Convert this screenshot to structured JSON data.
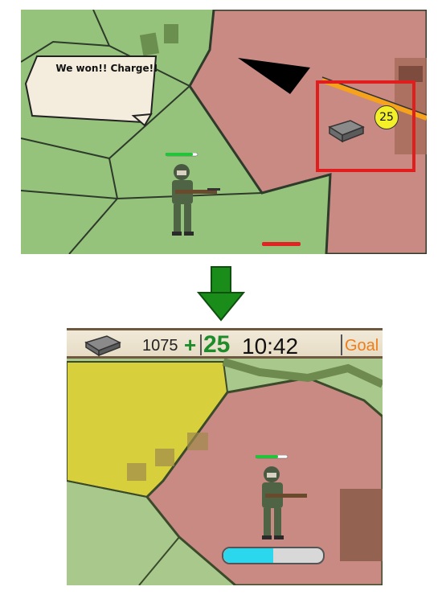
{
  "top_panel": {
    "speech_text": "We won!! Charge!!",
    "supply_counter": "25",
    "unit_health": 0.85,
    "enemy_health": 1.0
  },
  "arrow": {
    "color": "#1a8c1a",
    "direction": "down"
  },
  "bottom_panel": {
    "hud": {
      "ammo_count": "1075",
      "plus_sign": "+",
      "ammo_added": "25",
      "timer": "10:42",
      "goal_label": "Goal",
      "goal_color": "#f07d18"
    },
    "unit_health": 0.7,
    "progress": 0.5
  },
  "colors": {
    "friendly_territory": "#8fbf73",
    "enemy_territory": "#c78b85",
    "captured_territory": "#d3c940",
    "progress_fill": "#2ad7ec"
  },
  "icons": [
    "ammo-crate-icon",
    "soldier-sprite",
    "waypoint-arrow-icon",
    "down-arrow-icon"
  ]
}
